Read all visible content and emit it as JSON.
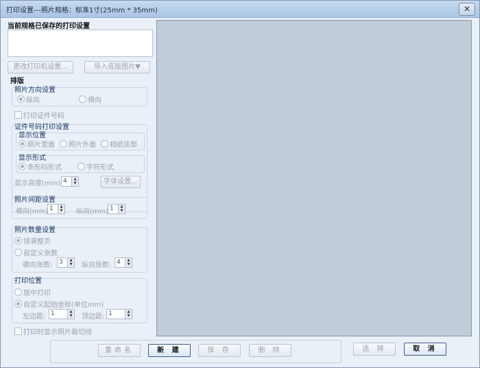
{
  "window": {
    "title": "打印设置---照片规格：标准1寸(25mm * 35mm)",
    "close_label": "✕"
  },
  "left": {
    "saved_header": "当前规格已保存的打印设置",
    "change_printer_button": "更改打印机设置...",
    "import_background_button": "导入底版图片▼",
    "layout_header": "排版",
    "orientation": {
      "title": "照片方向设置",
      "portrait": "纵向",
      "landscape": "横向"
    },
    "print_id_checkbox": "打印证件号码",
    "id_print": {
      "title": "证件号码打印设置",
      "position": {
        "title": "显示位置",
        "inside": "照片里面",
        "outside": "照片外面",
        "bottom": "相纸底部"
      },
      "form": {
        "title": "显示形式",
        "barcode": "条形码形式",
        "text": "字符形式"
      },
      "height_label": "显示高度(mm):",
      "height_value": "4",
      "font_button": "字体设置..."
    },
    "spacing": {
      "title": "照片间距设置",
      "h_label": "横向(mm):",
      "h_value": "1",
      "v_label": "纵向(mm):",
      "v_value": "1"
    },
    "count": {
      "title": "照片数量设置",
      "full_page": "排满整页",
      "custom": "自定义张数",
      "h_label": "横向张数:",
      "h_value": "3",
      "v_label": "纵向张数:",
      "v_value": "4"
    },
    "position": {
      "title": "打印位置",
      "center": "居中打印",
      "custom": "自定义起始坐标(单位mm)",
      "left_label": "左边距:",
      "left_value": "1",
      "top_label": "顶边距:",
      "top_value": "1"
    },
    "show_cut_lines_checkbox": "打印时显示照片裁切线"
  },
  "bottom": {
    "rename": "重命名",
    "new": "新 建",
    "save": "保 存",
    "delete": "删 除",
    "select": "选 择",
    "cancel": "取 消"
  }
}
